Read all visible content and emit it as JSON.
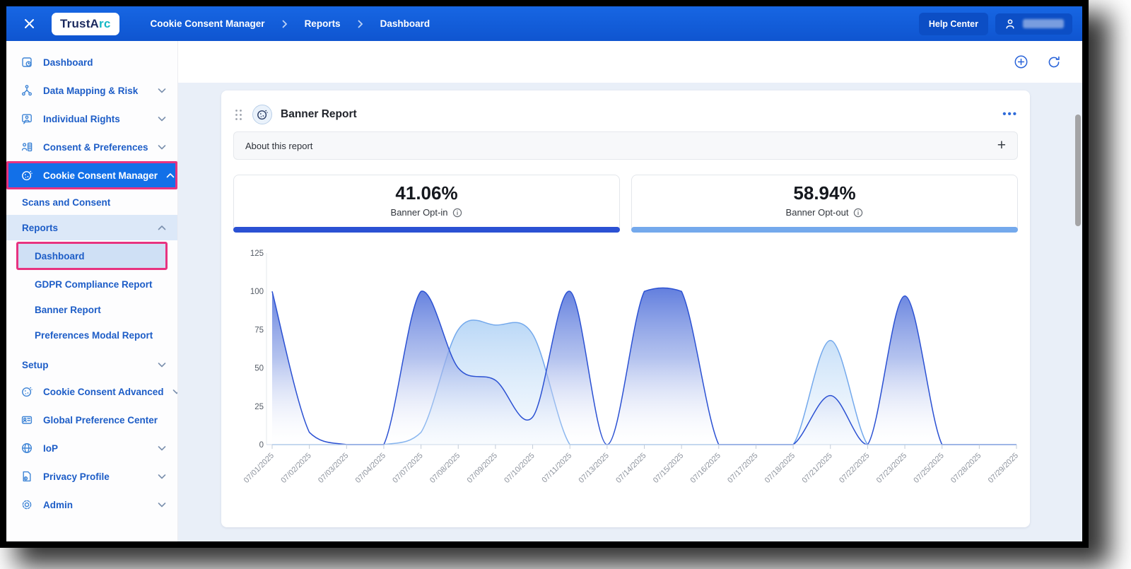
{
  "topbar": {
    "logo_prefix": "TrustA",
    "logo_suffix": "rc",
    "breadcrumb": [
      "Cookie Consent Manager",
      "Reports",
      "Dashboard"
    ],
    "help_center_label": "Help Center"
  },
  "icons": {
    "close": "close-icon",
    "breadcrumb_separator": "chevron-right-icon",
    "user": "person-icon",
    "add_widget": "plus-circle-icon",
    "refresh": "refresh-icon",
    "card_menu": "•••",
    "drag_handle": "drag-handle-dots-icon",
    "expand_about": "+",
    "info": "info-circle-icon"
  },
  "colors": {
    "topbar_blue": "#1160dc",
    "active_item_blue": "#1270e8",
    "annotation_magenta": "#e73380",
    "opt_in_accent": "#2b51d3",
    "opt_out_accent": "#74a9ec",
    "sidebar_link": "#1d5dc7"
  },
  "sidebar": {
    "items": [
      {
        "label": "Dashboard",
        "level": "top",
        "icon": "dashboard-icon"
      },
      {
        "label": "Data Mapping & Risk",
        "level": "top",
        "icon": "data-mapping-icon",
        "chevron": "down"
      },
      {
        "label": "Individual Rights",
        "level": "top",
        "icon": "individual-rights-icon",
        "chevron": "down"
      },
      {
        "label": "Consent & Preferences",
        "level": "top",
        "icon": "consent-preferences-icon",
        "chevron": "down"
      },
      {
        "label": "Cookie Consent Manager",
        "level": "top",
        "icon": "cookie-icon",
        "chevron": "up",
        "active": true,
        "highlighted": true
      },
      {
        "label": "Scans and Consent",
        "level": "sub"
      },
      {
        "label": "Reports",
        "level": "sub",
        "chevron": "up",
        "expanded": true
      },
      {
        "label": "Dashboard",
        "level": "subsub",
        "active": true,
        "highlighted": true
      },
      {
        "label": "GDPR Compliance Report",
        "level": "subsub"
      },
      {
        "label": "Banner Report",
        "level": "subsub"
      },
      {
        "label": "Preferences Modal Report",
        "level": "subsub"
      },
      {
        "label": "Setup",
        "level": "sub",
        "chevron": "down",
        "gap_before": true
      },
      {
        "label": "Cookie Consent Advanced",
        "level": "top",
        "icon": "cookie-icon",
        "chevron": "down"
      },
      {
        "label": "Global Preference Center",
        "level": "top",
        "icon": "preference-center-icon"
      },
      {
        "label": "IoP",
        "level": "top",
        "icon": "iop-globe-icon",
        "chevron": "down"
      },
      {
        "label": "Privacy Profile",
        "level": "top",
        "icon": "privacy-profile-icon",
        "chevron": "down"
      },
      {
        "label": "Admin",
        "level": "top",
        "icon": "admin-gear-icon",
        "chevron": "down"
      }
    ]
  },
  "report": {
    "title": "Banner Report",
    "about_label": "About this report",
    "stats": [
      {
        "value": "41.06%",
        "label": "Banner Opt-in",
        "accent": "#2b51d3"
      },
      {
        "value": "58.94%",
        "label": "Banner Opt-out",
        "accent": "#74a9ec"
      }
    ]
  },
  "chart_data": {
    "type": "area",
    "x": [
      "07/01/2025",
      "07/02/2025",
      "07/03/2025",
      "07/04/2025",
      "07/07/2025",
      "07/08/2025",
      "07/09/2025",
      "07/10/2025",
      "07/11/2025",
      "07/13/2025",
      "07/14/2025",
      "07/15/2025",
      "07/16/2025",
      "07/17/2025",
      "07/18/2025",
      "07/21/2025",
      "07/22/2025",
      "07/23/2025",
      "07/25/2025",
      "07/28/2025",
      "07/29/2025"
    ],
    "series": [
      {
        "name": "Banner Opt-in",
        "color": "#2b51d3",
        "values": [
          100,
          8,
          0,
          0,
          100,
          50,
          42,
          18,
          100,
          0,
          100,
          100,
          0,
          0,
          0,
          32,
          0,
          97,
          0,
          0,
          0
        ]
      },
      {
        "name": "Banner Opt-out",
        "color": "#74a9ec",
        "values": [
          0,
          0,
          0,
          0,
          8,
          75,
          78,
          72,
          0,
          0,
          0,
          0,
          0,
          0,
          0,
          68,
          0,
          0,
          0,
          0,
          0
        ]
      }
    ],
    "title": "",
    "xlabel": "",
    "ylabel": "",
    "ylim": [
      0,
      125
    ],
    "yticks": [
      0,
      25,
      50,
      75,
      100,
      125
    ],
    "grid": false,
    "legend": "none"
  }
}
